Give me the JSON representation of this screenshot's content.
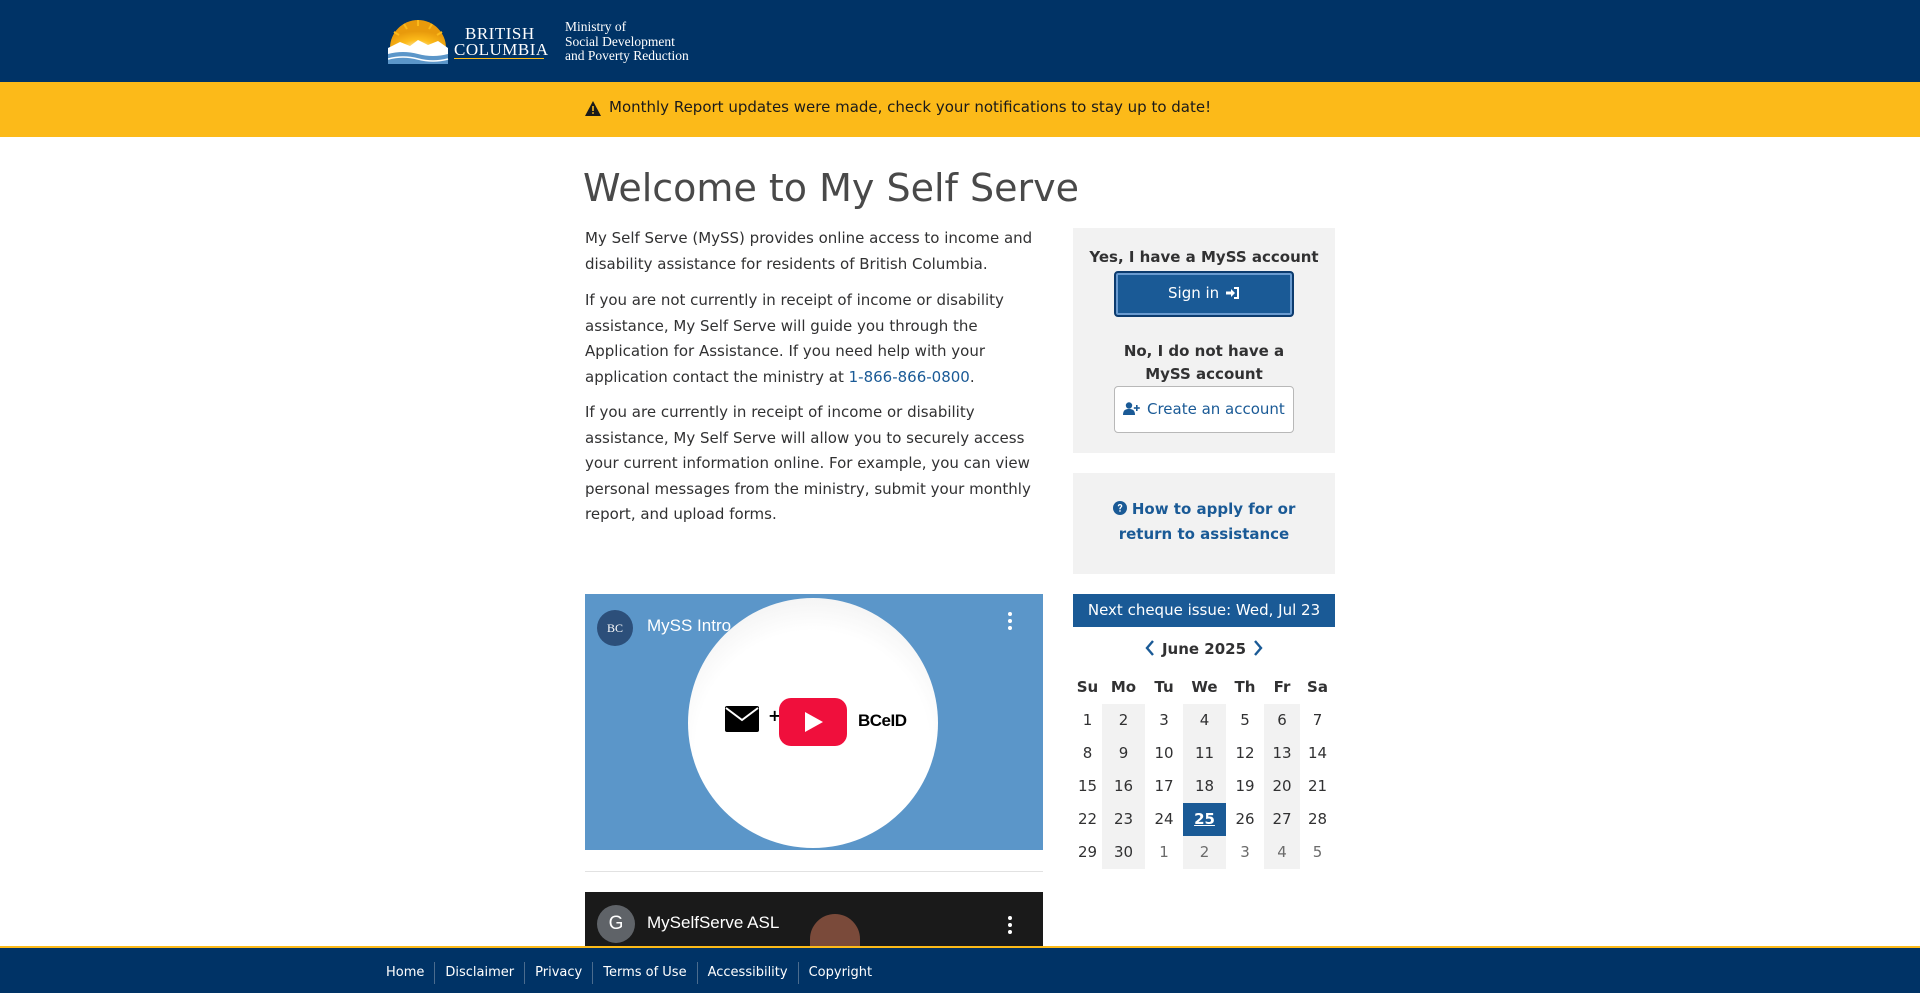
{
  "header": {
    "logo_line1": "BRITISH",
    "logo_line2": "COLUMBIA",
    "ministry_line1": "Ministry of",
    "ministry_line2": "Social Development",
    "ministry_line3": "and Poverty Reduction"
  },
  "banner": {
    "icon": "warning-icon",
    "text": "Monthly Report updates were made, check your notifications to stay up to date!"
  },
  "main": {
    "title": "Welcome to My Self Serve",
    "p1": "My Self Serve (MySS) provides online access to income and disability assistance for residents of British Columbia.",
    "p2_before": "If you are not currently in receipt of income or disability assistance, My Self Serve will guide you through the Application for Assistance. If you need help with your application contact the ministry at ",
    "p2_phone": "1-866-866-0800",
    "p2_after": ".",
    "p3": "If you are currently in receipt of income or disability assistance, My Self Serve will allow you to securely access your current information online. For example, you can view personal messages from the ministry, submit your monthly report, and upload forms."
  },
  "signin": {
    "has_account": "Yes, I have a MySS account",
    "signin_label": "Sign in",
    "no_account": "No, I do not have a MySS account",
    "create_label": "Create an account"
  },
  "howto": {
    "label": "How to apply for or return to assistance"
  },
  "calendar": {
    "cheque": "Next cheque issue: Wed, Jul 23",
    "month": "June 2025",
    "weekdays": [
      "Su",
      "Mo",
      "Tu",
      "We",
      "Th",
      "Fr",
      "Sa"
    ],
    "weeks": [
      [
        "1",
        "2",
        "3",
        "4",
        "5",
        "6",
        "7"
      ],
      [
        "8",
        "9",
        "10",
        "11",
        "12",
        "13",
        "14"
      ],
      [
        "15",
        "16",
        "17",
        "18",
        "19",
        "20",
        "21"
      ],
      [
        "22",
        "23",
        "24",
        "25",
        "26",
        "27",
        "28"
      ],
      [
        "29",
        "30",
        "1",
        "2",
        "3",
        "4",
        "5"
      ]
    ],
    "today": "25"
  },
  "videos": {
    "v1_avatar": "BC",
    "v1_title": "MySS Intro",
    "v1_plus": "+",
    "v1_brand": "BCeID",
    "v2_avatar": "G",
    "v2_title": "MySelfServe ASL"
  },
  "footer": {
    "links": [
      "Home",
      "Disclaimer",
      "Privacy",
      "Terms of Use",
      "Accessibility",
      "Copyright"
    ]
  },
  "colors": {
    "header_bg": "#003366",
    "banner_bg": "#fcba19",
    "accent": "#1a5a96"
  }
}
